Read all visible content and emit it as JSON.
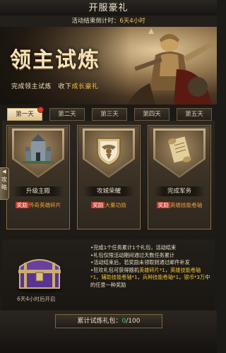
{
  "title": "开服豪礼",
  "countdown": {
    "prefix": "活动结束倒计时：",
    "value": "6天4小时"
  },
  "banner": {
    "heading": "领主试炼",
    "sub_prefix": "完成领主试炼　收下",
    "sub_highlight": "成长豪礼"
  },
  "tabs": [
    {
      "label": "第一天",
      "active": true,
      "dot": true
    },
    {
      "label": "第二天"
    },
    {
      "label": "第三天"
    },
    {
      "label": "第四天"
    },
    {
      "label": "第五天"
    }
  ],
  "side_tab": {
    "label": "攻略"
  },
  "cards": [
    {
      "icon": "castle-icon",
      "title": "升级主殿",
      "reward_tag": "奖励",
      "reward_text": "传奇英雄碎片"
    },
    {
      "icon": "eagle-crest-icon",
      "title": "攻城荣耀",
      "reward_tag": "奖励",
      "reward_text": "大量功勋"
    },
    {
      "icon": "scroll-icon",
      "title": "完成军务",
      "reward_tag": "奖励",
      "reward_text": "英雄技能卷轴"
    }
  ],
  "chest": {
    "icon": "treasure-chest-icon",
    "caption": "6天4小时后开启"
  },
  "rules": {
    "l1": "•完成1个任务累计1个礼包，活动结束",
    "l2": "•礼包仅限活动期间通过天数任务累计",
    "l3": "•活动结束后，若奖励未领取则通过邮件补发",
    "l4a": "•狂欢礼包可获得随机",
    "l4b": "英雄碎片*1",
    "l4c": "，",
    "l4d": "英雄技能卷轴",
    "l5a": "*1",
    "l5b": "，",
    "l5c": "辅助技能卷轴*1",
    "l5d": "，",
    "l5e": "兵种技能卷轴*1",
    "l5f": "，",
    "l5g": "银币*3万",
    "l5h": "中",
    "l6": "的任意一种奖励"
  },
  "progress": {
    "label": "累计试炼礼包：",
    "current": "0",
    "total": "/100"
  }
}
